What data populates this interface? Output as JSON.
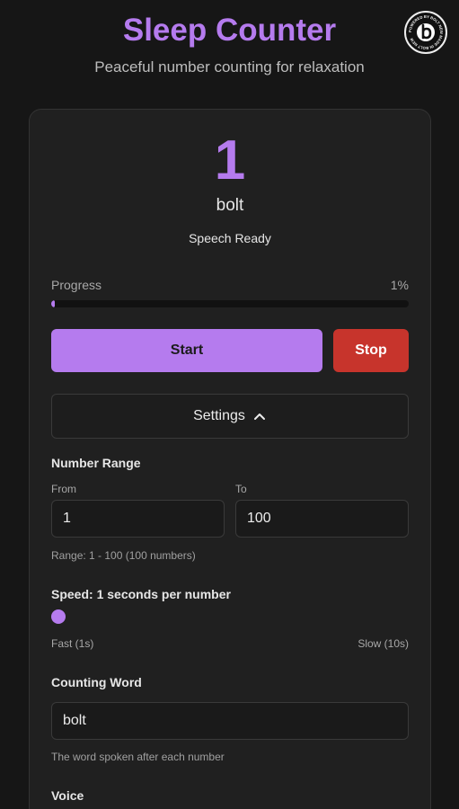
{
  "header": {
    "title": "Sleep Counter",
    "subtitle": "Peaceful number counting for relaxation",
    "badge_text": "POWERED BY BOLT NEW MADE IN BOLT NEW"
  },
  "counter": {
    "current_number": "1",
    "word": "bolt",
    "status": "Speech Ready"
  },
  "progress": {
    "label": "Progress",
    "percent_text": "1%",
    "percent_value": 1
  },
  "controls": {
    "start_label": "Start",
    "stop_label": "Stop"
  },
  "settings": {
    "toggle_label": "Settings",
    "number_range": {
      "label": "Number Range",
      "from_label": "From",
      "from_value": "1",
      "to_label": "To",
      "to_value": "100",
      "summary": "Range: 1 - 100 (100 numbers)"
    },
    "speed": {
      "label": "Speed: 1 seconds per number",
      "min_label": "Fast (1s)",
      "max_label": "Slow (10s)",
      "value": 1,
      "min": 1,
      "max": 10
    },
    "counting_word": {
      "label": "Counting Word",
      "value": "bolt",
      "hint": "The word spoken after each number"
    },
    "voice": {
      "label": "Voice"
    }
  },
  "colors": {
    "accent": "#b57bee",
    "stop": "#c7342c",
    "background": "#161616",
    "card": "#202020"
  }
}
